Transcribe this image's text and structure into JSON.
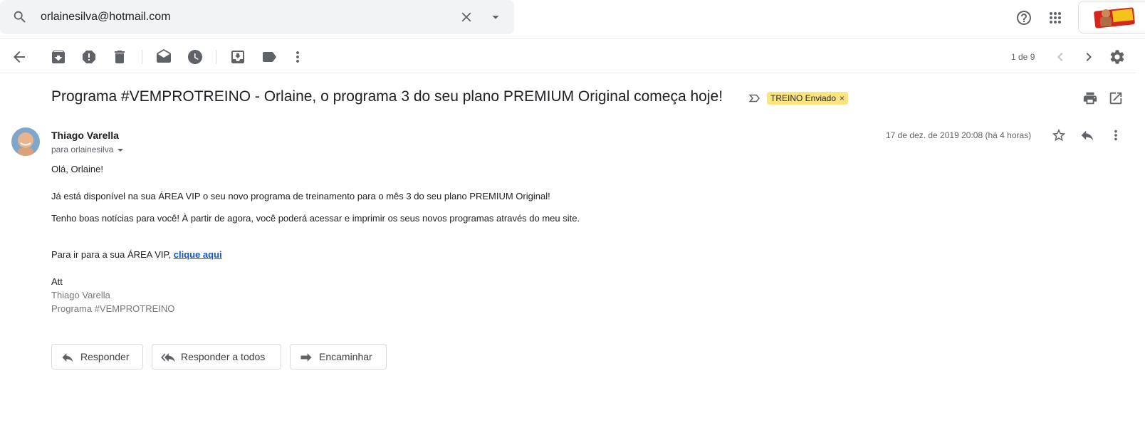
{
  "search": {
    "value": "orlainesilva@hotmail.com"
  },
  "toolbar": {
    "pager": "1 de 9"
  },
  "message": {
    "subject": "Programa #VEMPROTREINO - Orlaine, o programa 3 do seu plano PREMIUM Original começa hoje!",
    "label": "TREINO Enviado",
    "label_close": "×",
    "sender": "Thiago Varella",
    "to": "para orlainesilva",
    "date": "17 de dez. de 2019 20:08 (há 4 horas)",
    "body": {
      "greeting": "Olá, Orlaine!",
      "line1": "Já está disponível na sua ÁREA VIP o seu novo programa de treinamento para o mês 3 do seu plano PREMIUM Original!",
      "line2": "Tenho boas notícias para você! À partir de agora, você poderá acessar e imprimir os seus novos programas através do meu site.",
      "link_prefix": "Para ir para a sua ÁREA VIP, ",
      "link_text": "clique aqui",
      "att": "Att",
      "sig_name": "Thiago Varella",
      "sig_program": "Programa #VEMPROTREINO"
    }
  },
  "actions": {
    "reply": "Responder",
    "reply_all": "Responder a todos",
    "forward": "Encaminhar"
  },
  "colors": {
    "label_bg": "#fce57e",
    "link": "#1155cc",
    "icon": "#5f6368"
  }
}
